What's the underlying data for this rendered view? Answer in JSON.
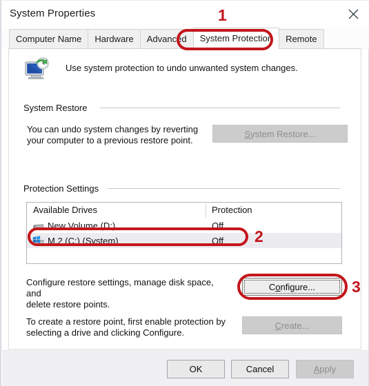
{
  "window": {
    "title": "System Properties",
    "close_icon": "close-icon"
  },
  "tabs": [
    {
      "label": "Computer Name",
      "active": false
    },
    {
      "label": "Hardware",
      "active": false
    },
    {
      "label": "Advanced",
      "active": false
    },
    {
      "label": "System Protection",
      "active": true
    },
    {
      "label": "Remote",
      "active": false
    }
  ],
  "intro": {
    "icon": "system-restore-icon",
    "text": "Use system protection to undo unwanted system changes."
  },
  "system_restore": {
    "group_label": "System Restore",
    "description_line1": "You can undo system changes by reverting",
    "description_line2": "your computer to a previous restore point.",
    "button": {
      "accel": "S",
      "label_rest": "ystem Restore...",
      "enabled": false
    }
  },
  "protection_settings": {
    "group_label": "Protection Settings",
    "columns": {
      "drives": "Available Drives",
      "protection": "Protection"
    },
    "rows": [
      {
        "icon": "hard-drive-icon",
        "name": "New Volume (D:)",
        "protection": "Off",
        "selected": false
      },
      {
        "icon": "system-drive-icon",
        "name": "M.2 (C:) (System)",
        "protection": "Off",
        "selected": true
      }
    ],
    "configure_description_line1": "Configure restore settings, manage disk space, and",
    "configure_description_line2": "delete restore points.",
    "configure_button": {
      "label_before": "C",
      "accel": "o",
      "label_after": "nfigure...",
      "enabled": true,
      "focused": true
    },
    "create_description_line1": "To create a restore point, first enable protection by",
    "create_description_line2": "selecting a drive and clicking Configure.",
    "create_button": {
      "accel": "C",
      "label_rest": "reate...",
      "enabled": false
    }
  },
  "footer": {
    "ok": "OK",
    "cancel": "Cancel",
    "apply": {
      "accel": "A",
      "label_rest": "pply",
      "enabled": false
    }
  },
  "annotations": {
    "color": "#c3161c",
    "markers": [
      {
        "number": "1",
        "target": "system-protection-tab"
      },
      {
        "number": "2",
        "target": "drive-row-m2-c"
      },
      {
        "number": "3",
        "target": "configure-button"
      }
    ]
  }
}
